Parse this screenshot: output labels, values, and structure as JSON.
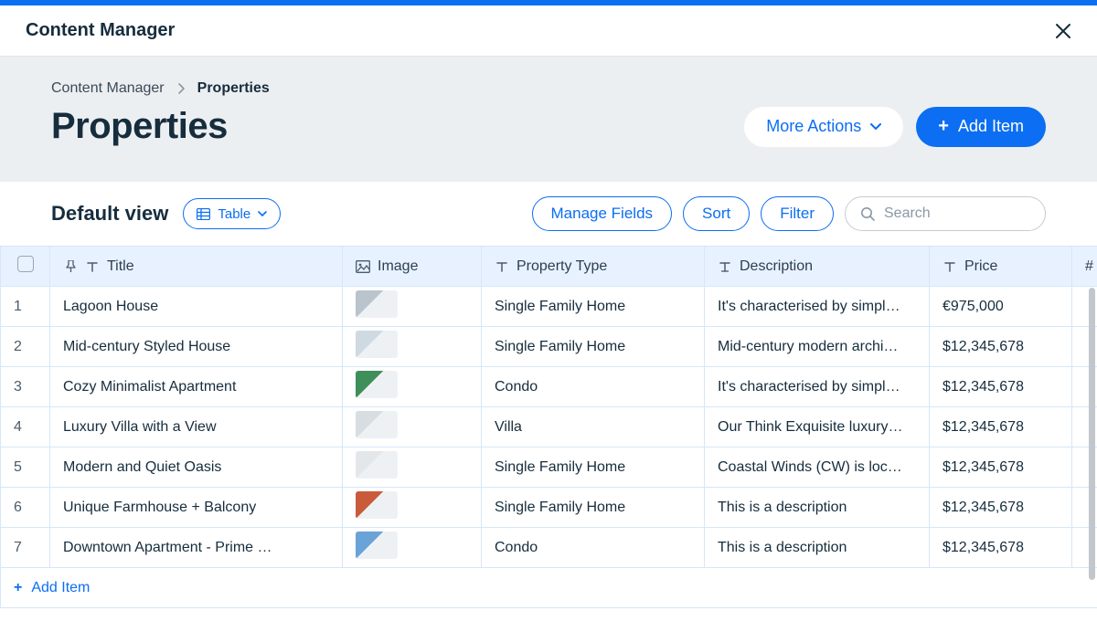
{
  "header": {
    "title": "Content Manager"
  },
  "breadcrumb": {
    "root": "Content Manager",
    "current": "Properties"
  },
  "page": {
    "title": "Properties"
  },
  "actions": {
    "more": "More Actions",
    "add": "Add Item"
  },
  "toolbar": {
    "view_label": "Default view",
    "view_mode": "Table",
    "manage_fields": "Manage Fields",
    "sort": "Sort",
    "filter": "Filter",
    "search_placeholder": "Search"
  },
  "columns": {
    "title": "Title",
    "image": "Image",
    "property_type": "Property Type",
    "description": "Description",
    "price": "Price",
    "extra": "#"
  },
  "footer": {
    "add_item": "Add Item"
  },
  "thumb_colors": [
    "#b9c4cc",
    "#cfd9e1",
    "#3f8f5a",
    "#d8dde2",
    "#e4e7ea",
    "#c95b3b",
    "#6aa3d8"
  ],
  "rows": [
    {
      "idx": "1",
      "title": "Lagoon House",
      "ptype": "Single Family Home",
      "desc": "It's characterised by simpl…",
      "price": "€975,000"
    },
    {
      "idx": "2",
      "title": "Mid-century Styled House",
      "ptype": "Single Family Home",
      "desc": "Mid-century modern archi…",
      "price": "$12,345,678"
    },
    {
      "idx": "3",
      "title": "Cozy Minimalist Apartment",
      "ptype": "Condo",
      "desc": "It's characterised by simpl…",
      "price": "$12,345,678"
    },
    {
      "idx": "4",
      "title": "Luxury Villa with a View",
      "ptype": "Villa",
      "desc": "Our Think Exquisite luxury…",
      "price": "$12,345,678"
    },
    {
      "idx": "5",
      "title": "Modern and Quiet Oasis",
      "ptype": "Single Family Home",
      "desc": "Coastal Winds (CW) is loc…",
      "price": "$12,345,678"
    },
    {
      "idx": "6",
      "title": "Unique Farmhouse + Balcony",
      "ptype": "Single Family Home",
      "desc": "This is a description",
      "price": "$12,345,678"
    },
    {
      "idx": "7",
      "title": "Downtown Apartment - Prime …",
      "ptype": "Condo",
      "desc": "This is a description",
      "price": "$12,345,678"
    }
  ]
}
